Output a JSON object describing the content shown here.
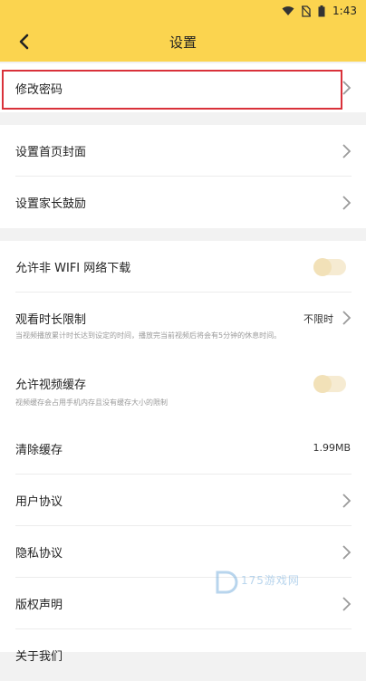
{
  "status_bar": {
    "time": "1:43",
    "icons": [
      "wifi-icon",
      "no-sim-icon",
      "battery-icon"
    ]
  },
  "app_bar": {
    "title": "设置",
    "back_icon": "chevron-left-icon"
  },
  "colors": {
    "header_bg": "#fbd44f",
    "page_bg": "#f2f2f2",
    "highlight_border": "#d9313a",
    "toggle_off": "#f2e1b8"
  },
  "groups": {
    "account": {
      "change_password": "修改密码"
    },
    "home": {
      "cover": "设置首页封面",
      "parent_encourage": "设置家长鼓励"
    },
    "playback": {
      "non_wifi_download": "允许非 WIFI 网络下载",
      "non_wifi_download_on": false,
      "watch_time_limit": "观看时长限制",
      "watch_time_limit_value": "不限时",
      "watch_time_limit_desc": "当视频播放累计时长达到设定的时间，播放完当前视频后将会有5分钟的休息时间。",
      "video_cache": "允许视频缓存",
      "video_cache_on": false,
      "video_cache_desc": "视频缓存会占用手机内存且没有缓存大小的限制",
      "clear_cache": "清除缓存",
      "clear_cache_size": "1.99MB",
      "user_agreement": "用户协议",
      "privacy_agreement": "隐私协议",
      "copyright": "版权声明",
      "about": "关于我们"
    }
  },
  "watermark": {
    "text": "175游戏网"
  }
}
